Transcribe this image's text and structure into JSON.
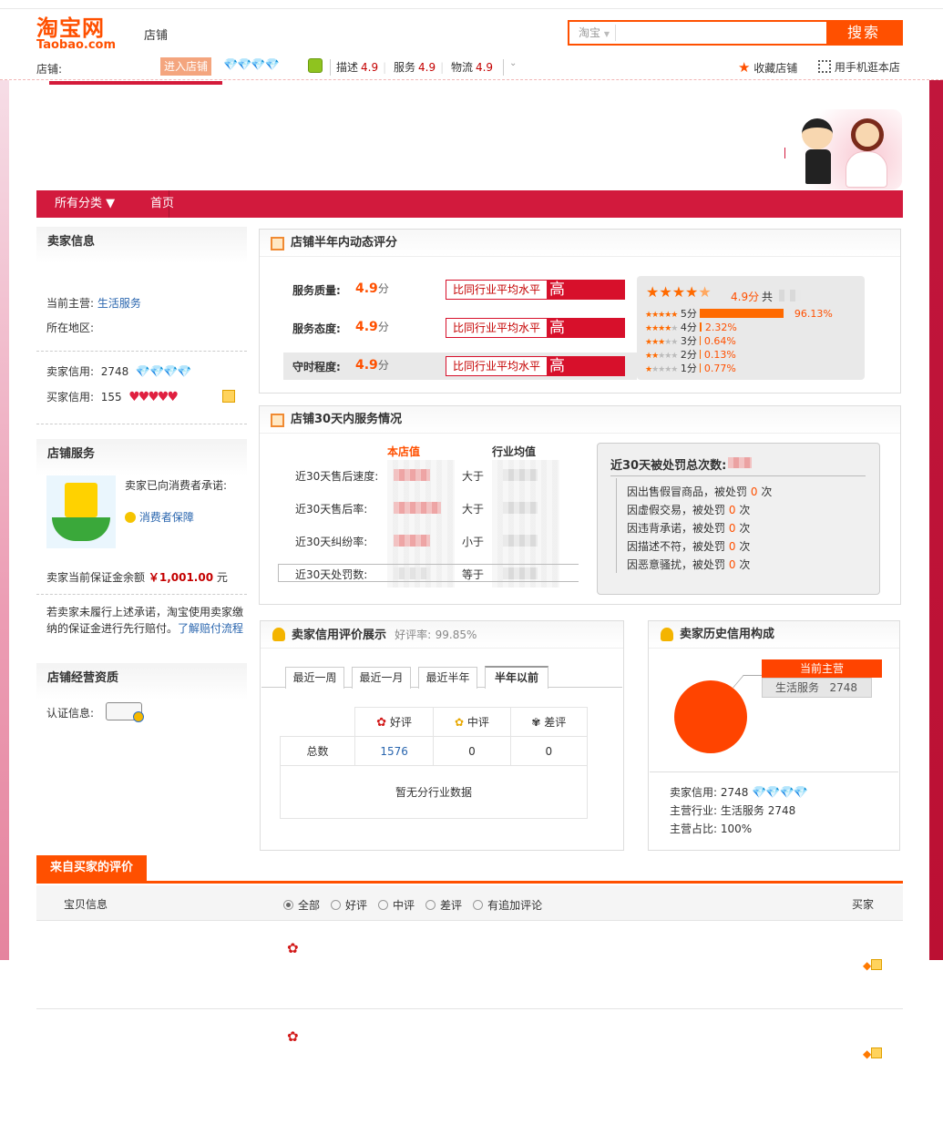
{
  "header": {
    "logo_cn": "淘宝网",
    "logo_en": "Taobao.com",
    "section_label": "店铺",
    "search_scope": "淘宝",
    "search_placeholder": "",
    "search_button": "搜索",
    "store_prefix": "店铺:",
    "enter_store": "进入店铺",
    "diamonds": "💎💎💎💎",
    "ratings": [
      {
        "label": "描述",
        "value": "4.9"
      },
      {
        "label": "服务",
        "value": "4.9"
      },
      {
        "label": "物流",
        "value": "4.9"
      }
    ],
    "fav_store": "收藏店铺",
    "mobile_store": "用手机逛本店"
  },
  "nav": {
    "all_categories": "所有分类 ▼",
    "home": "首页"
  },
  "seller_info": {
    "title": "卖家信息",
    "main_business_label": "当前主营:",
    "main_business_value": "生活服务",
    "location_label": "所在地区:",
    "seller_credit_label": "卖家信用:",
    "seller_credit_value": "2748",
    "seller_credit_icons": "💎💎💎💎",
    "buyer_credit_label": "买家信用:",
    "buyer_credit_value": "155",
    "buyer_credit_icons": "♥♥♥♥♥"
  },
  "store_service": {
    "title": "店铺服务",
    "promise_text": "卖家已向消费者承诺:",
    "protection": "消费者保障",
    "deposit_label": "卖家当前保证金余额",
    "deposit_value": "￥1,001.00",
    "deposit_unit": "元",
    "notice_text": "若卖家未履行上述承诺，淘宝使用卖家缴纳的保证金进行先行赔付。",
    "notice_link": "了解赔付流程"
  },
  "qualification": {
    "title": "店铺经营资质",
    "cert_label": "认证信息:"
  },
  "dsr": {
    "title": "店铺半年内动态评分",
    "rows": [
      {
        "label": "服务质量:",
        "score": "4.9",
        "unit": "分",
        "compare": "比同行业平均水平",
        "level": "高"
      },
      {
        "label": "服务态度:",
        "score": "4.9",
        "unit": "分",
        "compare": "比同行业平均水平",
        "level": "高"
      },
      {
        "label": "守时程度:",
        "score": "4.9",
        "unit": "分",
        "compare": "比同行业平均水平",
        "level": "高"
      }
    ],
    "summary_score": "4.9分",
    "summary_total_prefix": "共",
    "distribution": [
      {
        "label": "5分",
        "pct": "96.13%",
        "fraction": 0.9613
      },
      {
        "label": "4分",
        "pct": "2.32%",
        "fraction": 0.0232
      },
      {
        "label": "3分",
        "pct": "0.64%",
        "fraction": 0.0064
      },
      {
        "label": "2分",
        "pct": "0.13%",
        "fraction": 0.0013
      },
      {
        "label": "1分",
        "pct": "0.77%",
        "fraction": 0.0077
      }
    ]
  },
  "service30": {
    "title": "店铺30天内服务情况",
    "col_store": "本店值",
    "col_industry": "行业均值",
    "rows": [
      {
        "label": "近30天售后速度:",
        "cmp": "大于"
      },
      {
        "label": "近30天售后率:",
        "cmp": "大于"
      },
      {
        "label": "近30天纠纷率:",
        "cmp": "小于"
      },
      {
        "label": "近30天处罚数:",
        "cmp": "等于"
      }
    ],
    "penalty_title": "近30天被处罚总次数:",
    "penalties": [
      {
        "text": "因出售假冒商品，被处罚",
        "count": "0",
        "unit": "次"
      },
      {
        "text": "因虚假交易，被处罚",
        "count": "0",
        "unit": "次"
      },
      {
        "text": "因违背承诺，被处罚",
        "count": "0",
        "unit": "次"
      },
      {
        "text": "因描述不符，被处罚",
        "count": "0",
        "unit": "次"
      },
      {
        "text": "因恶意骚扰，被处罚",
        "count": "0",
        "unit": "次"
      }
    ]
  },
  "credit_eval": {
    "title": "卖家信用评价展示",
    "good_rate_label": "好评率:",
    "good_rate_value": "99.85%",
    "tabs": [
      "最近一周",
      "最近一月",
      "最近半年",
      "半年以前"
    ],
    "col_good": "好评",
    "col_mid": "中评",
    "col_bad": "差评",
    "row_label": "总数",
    "good": "1576",
    "mid": "0",
    "bad": "0",
    "no_data": "暂无分行业数据"
  },
  "credit_history": {
    "title": "卖家历史信用构成",
    "current_main": "当前主营",
    "category": "生活服务",
    "category_value": "2748",
    "seller_credit_label": "卖家信用:",
    "seller_credit_value": "2748",
    "main_industry_label": "主营行业:",
    "main_industry_value": "生活服务 2748",
    "main_share_label": "主营占比:",
    "main_share_value": "100%",
    "pie_color": "#ff4400"
  },
  "buyer_reviews": {
    "tab": "来自买家的评价",
    "col_item": "宝贝信息",
    "filters": [
      "全部",
      "好评",
      "中评",
      "差评",
      "有追加评论"
    ],
    "col_buyer": "买家"
  },
  "colors": {
    "brand": "#ff5000",
    "nav_red": "#d21a3d",
    "link": "#2965ae"
  }
}
